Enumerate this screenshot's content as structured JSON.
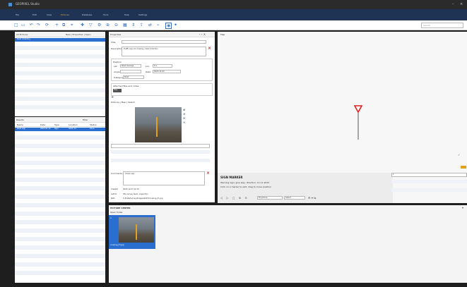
{
  "window": {
    "title": "GEOPIXEL Studio"
  },
  "menu": [
    "File",
    "Edit",
    "View",
    "Pictures",
    "Database",
    "Tools",
    "Help",
    "Settings"
  ],
  "search": {
    "placeholder": "Search"
  },
  "left_top": {
    "title": "All Pictures",
    "tools": "New | Properties | Open",
    "first_row": "Road inventory"
  },
  "left_bottom": {
    "title": "Results",
    "tools": "Filter",
    "columns": [
      "Name",
      "Date",
      "Type",
      "Location",
      "Status"
    ],
    "row": [
      "Road sign",
      "2023-01-12",
      "Sign",
      "North 12",
      "Done"
    ]
  },
  "detail": {
    "title": "Properties",
    "name_label": "Title",
    "desc_label": "Description",
    "desc_value": "Traffic sign at crossing, check direction",
    "section_location": "Position",
    "lat_label": "Lat",
    "lat_value": "Road Average",
    "lon_label": "Lon",
    "lon_value": "0.1",
    "bearing_label": "Angle",
    "date_label": "Date",
    "date_value": "2023-12-03",
    "kind_label": "Category",
    "kind_value": "Road",
    "attach_title": "Attached files and notes",
    "attach_tab": "Files",
    "photo_tabs": "Pictures | Map | Sketch",
    "note_label": "Comments",
    "note_value": "Check sign",
    "meta1_label": "Created",
    "meta1_value": "2023-12-03 12:34",
    "meta2_label": "Author",
    "meta2_value": "Site survey team, inspection",
    "meta3_label": "Path",
    "meta3_value": "C:/Data/Survey/Images/2023/crossing_01.jpg"
  },
  "viewer": {
    "label": "Map",
    "info_title": "SIGN MARKER",
    "info_line1": "Warning sign: give way, direction: 11-11-2023",
    "info_line2": "Click on a marker to edit, drag to move position",
    "zoom_select": "Fit picture",
    "mode_select": "Select",
    "side_value": "1"
  },
  "gallery": {
    "title": "PICTURE CENTER",
    "subtitle": "Open folder",
    "thumb_label": "crossing_01.jpg",
    "thumb_index": "1"
  },
  "colors": {
    "accent": "#2a6fd0",
    "menubar": "#1f3354",
    "marker": "#d8231f"
  }
}
